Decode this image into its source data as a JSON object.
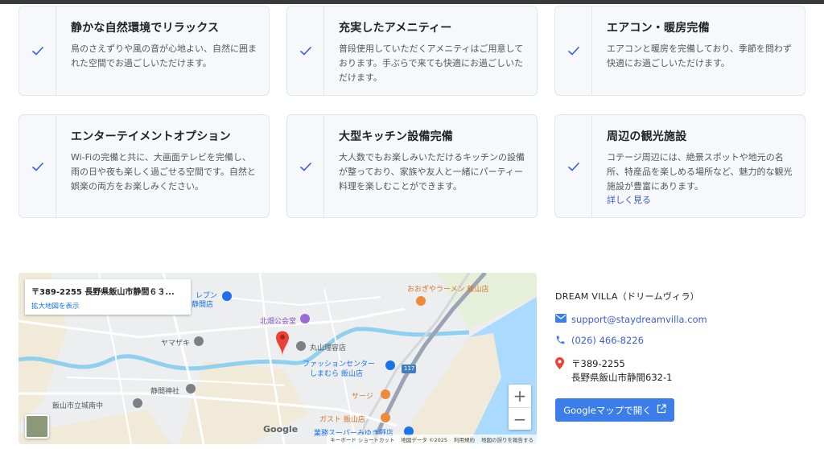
{
  "features": [
    {
      "title": "静かな自然環境でリラックス",
      "desc": "鳥のさえずりや風の音が心地よい、自然に囲まれた空間でお過ごしいただけます。",
      "more": ""
    },
    {
      "title": "充実したアメニティー",
      "desc": "普段使用していただくアメニティはご用意しております。手ぶらで来ても快適にお過ごしいただけます。",
      "more": ""
    },
    {
      "title": "エアコン・暖房完備",
      "desc": "エアコンと暖房を完備しており、季節を問わず快適にお過ごしいただけます。",
      "more": ""
    },
    {
      "title": "エンターテイメントオプション",
      "desc": "Wi-Fiの完備と共に、大画面テレビを完備し、雨の日や夜も楽しく過ごせる空間です。自然と娯楽の両方をお楽しみください。",
      "more": ""
    },
    {
      "title": "大型キッチン設備完備",
      "desc": "大人数でもお楽しみいただけるキッチンの設備が整っており、家族や友人と一緒にパーティー料理を楽しむことができます。",
      "more": ""
    },
    {
      "title": "周辺の観光施設",
      "desc": "コテージ周辺には、絶景スポットや地元の名所、特産品を楽しめる場所など、魅力的な観光施設が豊富にあります。",
      "more": "詳しく見る"
    }
  ],
  "map": {
    "address": "〒389-2255 長野県飯山市静間６３...",
    "enlarge": "拡大地図を表示",
    "labels": {
      "seven": "レブン",
      "shizuma": "静間店",
      "ookiya": "おおぎやラーメン 飯山店",
      "kitahata": "北畑公会堂",
      "yamazaki": "ヤマザキ",
      "maruyama": "丸山理容店",
      "fashion": "ファッションセンター",
      "shimamura": "しまむら 飯山店",
      "shrine": "静間神社",
      "school": "飯山市立城南中",
      "sage": "サージ",
      "gusto": "ガスト 飯山店",
      "super": "業務スーパーみゆき野店",
      "road": "117"
    },
    "google": "Google",
    "footer": [
      "キーボード ショートカット",
      "地図データ ©2025",
      "利用規約",
      "地図の誤りを報告する"
    ],
    "zoom_in": "+",
    "zoom_out": "−"
  },
  "contact": {
    "name": "DREAM VILLA（ドリームヴィラ）",
    "email": "support@staydreamvilla.com",
    "phone": "(026) 466-8226",
    "zip": "〒389-2255",
    "address": "長野県飯山市静間632-1",
    "button": "Googleマップで開く"
  },
  "colors": {
    "accent": "#3b5bdb",
    "button": "#3b7de9",
    "pin": "#ea4335"
  }
}
